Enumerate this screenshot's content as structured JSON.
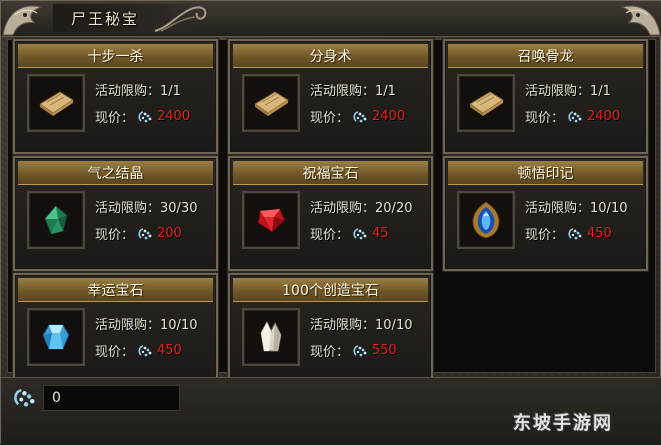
{
  "window": {
    "title": "尸王秘宝"
  },
  "items": [
    {
      "name": "十步一杀",
      "limit_label": "活动限购：",
      "limit_value": "1/1",
      "price_label": "现价：",
      "price": "2400",
      "icon": "scroll-icon"
    },
    {
      "name": "分身术",
      "limit_label": "活动限购：",
      "limit_value": "1/1",
      "price_label": "现价：",
      "price": "2400",
      "icon": "scroll-icon"
    },
    {
      "name": "召唤骨龙",
      "limit_label": "活动限购：",
      "limit_value": "1/1",
      "price_label": "现价：",
      "price": "2400",
      "icon": "scroll-icon"
    },
    {
      "name": "气之结晶",
      "limit_label": "活动限购：",
      "limit_value": "30/30",
      "price_label": "现价：",
      "price": "200",
      "icon": "green-crystal-icon"
    },
    {
      "name": "祝福宝石",
      "limit_label": "活动限购：",
      "limit_value": "20/20",
      "price_label": "现价：",
      "price": "45",
      "icon": "red-gem-icon"
    },
    {
      "name": "顿悟印记",
      "limit_label": "活动限购：",
      "limit_value": "10/10",
      "price_label": "现价：",
      "price": "450",
      "icon": "blue-seal-icon"
    },
    {
      "name": "幸运宝石",
      "limit_label": "活动限购：",
      "limit_value": "10/10",
      "price_label": "现价：",
      "price": "450",
      "icon": "blue-gem-icon"
    },
    {
      "name": "100个创造宝石",
      "limit_label": "活动限购：",
      "limit_value": "10/10",
      "price_label": "现价：",
      "price": "550",
      "icon": "white-crystal-icon"
    }
  ],
  "balance": {
    "value": "0",
    "icon": "currency-icon"
  },
  "watermark": "东坡手游网",
  "colors": {
    "price": "#e8201b",
    "header_gold": "#8a6e38",
    "frame": "#6e6557"
  }
}
